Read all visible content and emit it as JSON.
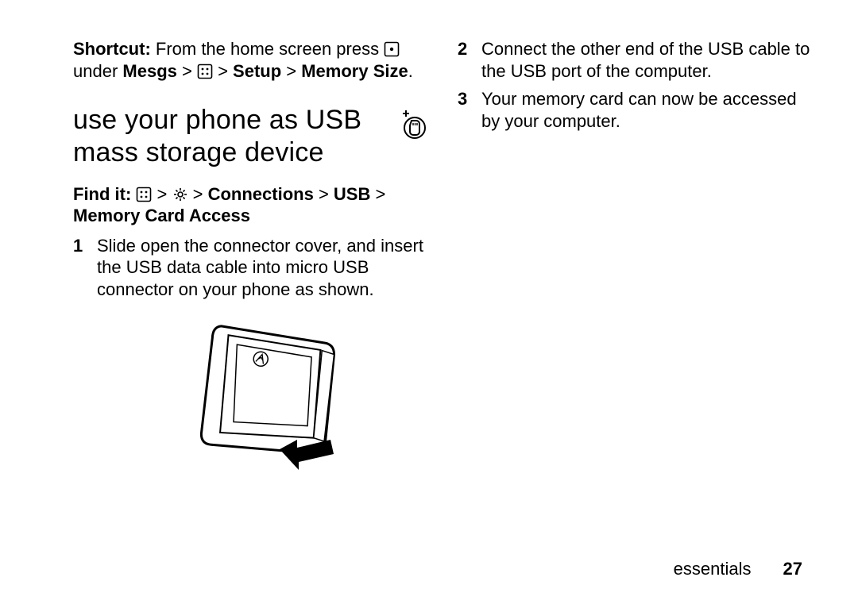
{
  "left": {
    "shortcut_label": "Shortcut:",
    "shortcut_text_1": " From the home screen press ",
    "shortcut_text_2": "under ",
    "shortcut_path_1": "Mesgs",
    "shortcut_path_2": "Setup",
    "shortcut_path_3": "Memory Size",
    "section_title": "use your phone as USB mass storage device",
    "findit_label": "Find it:",
    "findit_path_1": "Connections",
    "findit_path_2": "USB",
    "findit_path_3": "Memory Card Access",
    "step_1": "Slide open the connector cover, and insert the USB data cable into micro USB connector on your phone as shown."
  },
  "right": {
    "step_2": "Connect the other end of the USB cable to the USB port of the computer.",
    "step_3": "Your memory card can now be accessed by your computer."
  },
  "footer": {
    "section": "essentials",
    "page": "27"
  },
  "gt": " > ",
  "period": "."
}
